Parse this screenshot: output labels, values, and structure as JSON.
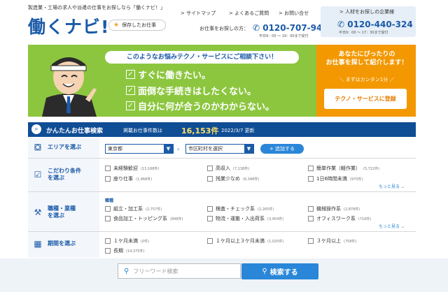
{
  "header": {
    "tagline": "製造業・工場の求人や派遣の仕事をお探しなら「働くナビ！」",
    "logo": "働くナビ!",
    "fav_label": "保存したお仕事",
    "nav": [
      "> サイトマップ",
      "> よくあるご質問",
      "> お問い合せ"
    ],
    "job_seeker_label": "お仕事をお探しの方：",
    "job_seeker_phone": "0120-707-942",
    "job_seeker_hours": "平日9：00 ～ 19：00まで受付",
    "corp_title": "> 人材をお探しの企業様",
    "corp_phone": "0120-440-324",
    "corp_hours": "平日9：00 ～ 17：30まで受付"
  },
  "banner": {
    "bubble": "このようなお悩みテクノ・サービスにご相談下さい！",
    "checks": [
      "すぐに働きたい。",
      "面倒な手続きはしたくない。",
      "自分に何が合うのかわからない。"
    ],
    "orange_head": "あなたにぴったりの\nお仕事を探して紹介します！",
    "orange_sub": "＼ まずはカンタン1分 ／",
    "register_label": "テクノ・サービスに登録",
    "colors": {
      "green": "#8cc63f",
      "orange": "#f39800"
    }
  },
  "search": {
    "title": "かんたんお仕事検索",
    "count_label": "掲載お仕事件数は",
    "count": "16,153件",
    "date": "2022/3/7 更新",
    "area": {
      "label": "エリアを選ぶ",
      "prefecture": "東京都",
      "city_placeholder": "市区町村を選択",
      "add_label": "+ 追加する"
    },
    "conditions": {
      "label": "こだわり条件\nを選ぶ",
      "items": [
        {
          "name": "未経験歓迎",
          "count": "(13,168件)"
        },
        {
          "name": "高収入",
          "count": "(7,138件)"
        },
        {
          "name": "簡単作業（軽作業）",
          "count": "(5,722件)"
        },
        {
          "name": "座り仕事",
          "count": "(1,968件)"
        },
        {
          "name": "残業少なめ",
          "count": "(6,348件)"
        },
        {
          "name": "1日6時間未満",
          "count": "(970件)"
        }
      ],
      "more": "もっと見る ⌄"
    },
    "jobtype": {
      "label": "職種・業種\nを選ぶ",
      "category": "職種",
      "items": [
        {
          "name": "組立・加工系",
          "count": "(2,757件)"
        },
        {
          "name": "検査・チェック系",
          "count": "(2,265件)"
        },
        {
          "name": "機械操作系",
          "count": "(2,878件)"
        },
        {
          "name": "食品加工・トッピング系",
          "count": "(846件)"
        },
        {
          "name": "物流・運搬・入出荷系",
          "count": "(3,954件)"
        },
        {
          "name": "オフィスワーク系",
          "count": "(716件)"
        }
      ],
      "more": "もっと見る ⌄"
    },
    "period": {
      "label": "期間を選ぶ",
      "items": [
        {
          "name": "１ケ月未満",
          "count": "(0件)"
        },
        {
          "name": "１ケ月以上３ケ月未満",
          "count": "(1,020件)"
        },
        {
          "name": "３ケ月以上",
          "count": "(758件)"
        },
        {
          "name": "長期",
          "count": "(14,375件)"
        }
      ]
    },
    "keyword_placeholder": "フリーワード検索",
    "button_label": "検索する"
  }
}
